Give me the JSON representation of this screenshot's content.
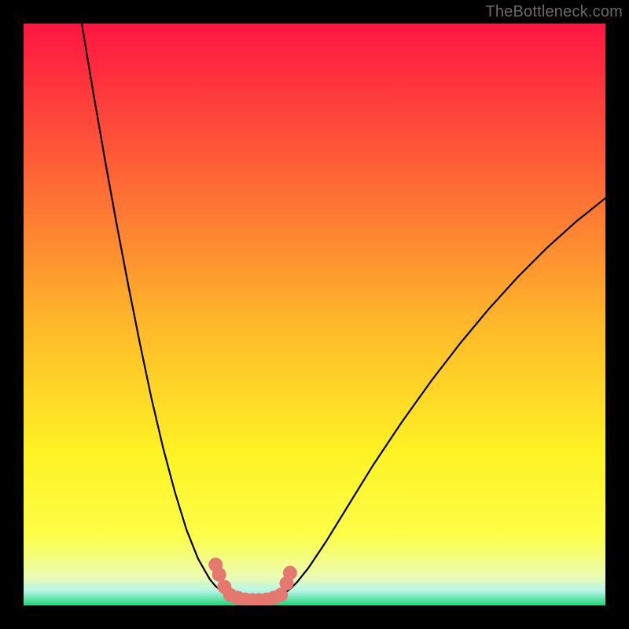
{
  "watermark": "TheBottleneck.com",
  "colors": {
    "frame": "#000000",
    "watermark_text": "#6a6a6a",
    "curve_stroke": "#000000",
    "marker_fill": "#e5796f",
    "marker_stroke": "#c24b44",
    "gradient": {
      "top": "#fe1542",
      "q1": "#fe6436",
      "mid": "#ffb92a",
      "q3": "#fef324",
      "low": "#fdfe48",
      "nearbase": "#eefcb0",
      "base_top": "#b7f6e7",
      "base_bot": "#1ed57a"
    }
  },
  "chart_data": {
    "type": "line",
    "title": "",
    "xlabel": "",
    "ylabel": "",
    "xlim": [
      0,
      100
    ],
    "ylim": [
      0,
      100
    ],
    "grid": false,
    "legend": null,
    "annotations": [],
    "series": [
      {
        "name": "left-branch",
        "x": [
          10.0,
          12.0,
          14.0,
          16.0,
          18.0,
          20.0,
          22.0,
          24.0,
          26.0,
          28.0,
          30.0,
          32.0,
          33.0,
          34.0,
          35.0,
          36.0
        ],
        "y": [
          100.0,
          88.0,
          76.5,
          65.5,
          55.0,
          45.0,
          35.5,
          27.0,
          19.5,
          13.0,
          8.0,
          4.5,
          3.3,
          2.5,
          2.0,
          1.8
        ]
      },
      {
        "name": "right-branch",
        "x": [
          44.0,
          45.0,
          46.0,
          47.0,
          49.0,
          52.0,
          56.0,
          60.0,
          65.0,
          70.0,
          75.0,
          80.0,
          85.0,
          90.0,
          95.0,
          100.0
        ],
        "y": [
          1.8,
          2.2,
          3.0,
          4.0,
          6.5,
          11.0,
          17.5,
          24.0,
          31.5,
          38.5,
          45.0,
          51.0,
          56.5,
          61.5,
          66.0,
          70.0
        ]
      },
      {
        "name": "valley-floor",
        "x": [
          36.0,
          37.0,
          38.0,
          39.0,
          40.0,
          41.0,
          42.0,
          43.0,
          44.0
        ],
        "y": [
          1.8,
          1.3,
          1.0,
          0.9,
          0.9,
          0.9,
          1.0,
          1.3,
          1.8
        ]
      }
    ],
    "markers": [
      {
        "series": "left-markers",
        "points": [
          {
            "x": 33.0,
            "y": 7.0
          },
          {
            "x": 33.6,
            "y": 5.3
          },
          {
            "x": 34.5,
            "y": 3.2
          }
        ]
      },
      {
        "series": "right-markers",
        "points": [
          {
            "x": 45.2,
            "y": 3.8
          },
          {
            "x": 45.8,
            "y": 5.6
          }
        ]
      },
      {
        "series": "valley-markers",
        "points": [
          {
            "x": 35.5,
            "y": 1.8
          },
          {
            "x": 36.8,
            "y": 1.3
          },
          {
            "x": 38.0,
            "y": 1.0
          },
          {
            "x": 39.3,
            "y": 0.9
          },
          {
            "x": 40.5,
            "y": 0.9
          },
          {
            "x": 41.8,
            "y": 1.0
          },
          {
            "x": 43.0,
            "y": 1.3
          },
          {
            "x": 44.2,
            "y": 1.8
          }
        ]
      }
    ]
  }
}
